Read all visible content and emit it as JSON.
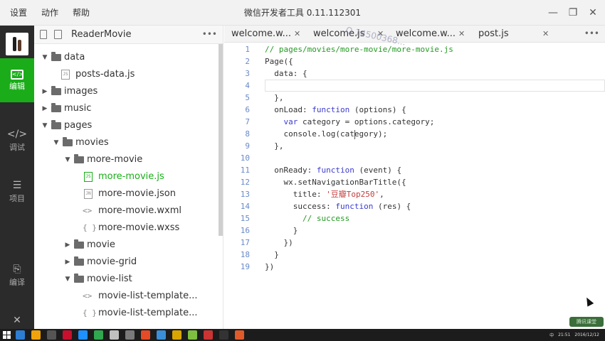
{
  "menu": {
    "settings": "设置",
    "actions": "动作",
    "help": "帮助"
  },
  "app_title": "微信开发者工具 0.11.112301",
  "leftbar": {
    "items": [
      {
        "label": "编辑",
        "icon": "code-icon"
      },
      {
        "label": "调试",
        "icon": "debug-icon"
      },
      {
        "label": "项目",
        "icon": "list-icon"
      },
      {
        "label": "编译",
        "icon": "compile-icon"
      }
    ],
    "close_glyph": "✕"
  },
  "tree": {
    "project": "ReaderMovie",
    "more": "•••",
    "rows": [
      {
        "label": "data",
        "type": "folder",
        "caret": "▼",
        "indent": 0
      },
      {
        "label": "posts-data.js",
        "type": "file",
        "badge": "JS",
        "indent": 1
      },
      {
        "label": "images",
        "type": "folder",
        "caret": "▶",
        "indent": 0
      },
      {
        "label": "music",
        "type": "folder",
        "caret": "▶",
        "indent": 0
      },
      {
        "label": "pages",
        "type": "folder",
        "caret": "▼",
        "indent": 0
      },
      {
        "label": "movies",
        "type": "folder",
        "caret": "▼",
        "indent": 1
      },
      {
        "label": "more-movie",
        "type": "folder",
        "caret": "▼",
        "indent": 2
      },
      {
        "label": "more-movie.js",
        "type": "file",
        "badge": "JS",
        "indent": 3,
        "active": true
      },
      {
        "label": "more-movie.json",
        "type": "file",
        "badge": "JN",
        "indent": 3
      },
      {
        "label": "more-movie.wxml",
        "type": "glyph",
        "glyph": "<>",
        "indent": 3
      },
      {
        "label": "more-movie.wxss",
        "type": "glyph",
        "glyph": "{ }",
        "indent": 3
      },
      {
        "label": "movie",
        "type": "folder",
        "caret": "▶",
        "indent": 2
      },
      {
        "label": "movie-grid",
        "type": "folder",
        "caret": "▶",
        "indent": 2
      },
      {
        "label": "movie-list",
        "type": "folder",
        "caret": "▼",
        "indent": 2
      },
      {
        "label": "movie-list-template...",
        "type": "glyph",
        "glyph": "<>",
        "indent": 3
      },
      {
        "label": "movie-list-template...",
        "type": "glyph",
        "glyph": "{ }",
        "indent": 3
      }
    ]
  },
  "tabs": [
    {
      "label": "welcome.w..."
    },
    {
      "label": "welcome.js"
    },
    {
      "label": "welcome.w..."
    },
    {
      "label": "post.js"
    }
  ],
  "tabs_close": "✕",
  "tabs_more": "•••",
  "code": {
    "lines": [
      [
        {
          "t": "// pages/movies/more-movie/more-movie.js",
          "c": "cmt"
        }
      ],
      [
        {
          "t": "Page({",
          "c": ""
        }
      ],
      [
        {
          "t": "  data: {",
          "c": ""
        }
      ],
      [
        {
          "t": "",
          "c": ""
        }
      ],
      [
        {
          "t": "  },",
          "c": ""
        }
      ],
      [
        {
          "t": "  onLoad: ",
          "c": ""
        },
        {
          "t": "function",
          "c": "kw"
        },
        {
          "t": " (options) {",
          "c": ""
        }
      ],
      [
        {
          "t": "    ",
          "c": ""
        },
        {
          "t": "var",
          "c": "kw"
        },
        {
          "t": " category = options.category;",
          "c": ""
        }
      ],
      [
        {
          "t": "    console.log(category);",
          "c": ""
        }
      ],
      [
        {
          "t": "  },",
          "c": ""
        }
      ],
      [
        {
          "t": "",
          "c": ""
        }
      ],
      [
        {
          "t": "  onReady: ",
          "c": ""
        },
        {
          "t": "function",
          "c": "kw"
        },
        {
          "t": " (event) {",
          "c": ""
        }
      ],
      [
        {
          "t": "    wx.setNavigationBarTitle({",
          "c": ""
        }
      ],
      [
        {
          "t": "      title: ",
          "c": ""
        },
        {
          "t": "'豆瓣Top250'",
          "c": "str"
        },
        {
          "t": ",",
          "c": ""
        }
      ],
      [
        {
          "t": "      success: ",
          "c": ""
        },
        {
          "t": "function",
          "c": "kw"
        },
        {
          "t": " (res) {",
          "c": ""
        }
      ],
      [
        {
          "t": "        ",
          "c": ""
        },
        {
          "t": "// success",
          "c": "cmt"
        }
      ],
      [
        {
          "t": "      }",
          "c": ""
        }
      ],
      [
        {
          "t": "    })",
          "c": ""
        }
      ],
      [
        {
          "t": "  }",
          "c": ""
        }
      ],
      [
        {
          "t": "})",
          "c": ""
        }
      ]
    ]
  },
  "watermark": "Q 14500368...",
  "overlay_logo": "腾讯课堂",
  "taskbar": {
    "tray": [
      "21:51",
      "2016/12/12",
      "中"
    ],
    "app_colors": [
      "#2d7dd2",
      "#f0a30a",
      "#555555",
      "#c8102e",
      "#1e90ff",
      "#2fa84f",
      "#c0c0c0",
      "#7a7a7a",
      "#e34c26",
      "#3a8fd8",
      "#d9a600",
      "#7fbf3f",
      "#cc3333",
      "#333333",
      "#e05a2b"
    ]
  }
}
